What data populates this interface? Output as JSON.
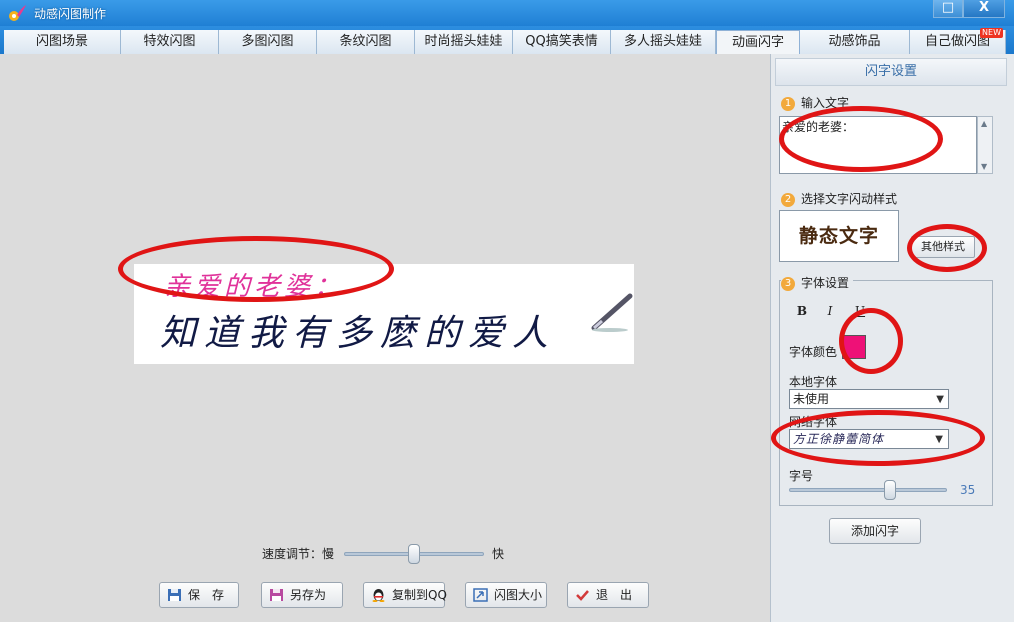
{
  "window": {
    "title": "动感闪图制作",
    "maximize_glyph": "□",
    "close_glyph": "X"
  },
  "tabs": [
    {
      "label": "闪图场景"
    },
    {
      "label": "特效闪图"
    },
    {
      "label": "多图闪图"
    },
    {
      "label": "条纹闪图"
    },
    {
      "label": "时尚摇头娃娃"
    },
    {
      "label": "QQ搞笑表情"
    },
    {
      "label": "多人摇头娃娃"
    },
    {
      "label": "动画闪字",
      "active": true
    },
    {
      "label": "动感饰品"
    },
    {
      "label": "自己做闪图",
      "badge": "NEW"
    }
  ],
  "preview": {
    "line1": "亲爱的老婆：",
    "line2": "知道我有多麽的爱人"
  },
  "speed": {
    "label": "速度调节：慢",
    "fast_label": "快",
    "level": 0.5
  },
  "buttons": {
    "save": "保　存",
    "save_as": "另存为",
    "copy_qq": "复制到QQ",
    "size": "闪图大小",
    "exit": "退　出"
  },
  "panel": {
    "title": "闪字设置",
    "step1": {
      "num": "1",
      "label": "输入文字",
      "text_value": "亲爱的老婆："
    },
    "step2": {
      "num": "2",
      "label": "选择文字闪动样式",
      "style_preview": "静态文字",
      "other_style": "其他样式"
    },
    "step3": {
      "num": "3",
      "label": "字体设置",
      "bold": "B",
      "italic": "I",
      "underline": "U",
      "color_label": "字体颜色",
      "font_color": "#ee1177",
      "local_font_label": "本地字体",
      "local_font_value": "未使用",
      "net_font_label": "网络字体",
      "net_font_value": "方正徐静蕾简体",
      "size_label": "字号",
      "size_value": "35",
      "size_level": 0.64
    },
    "add_button": "添加闪字"
  },
  "accent_colors": {
    "title_bar": "#1f7fd4",
    "annotation": "#e01515"
  }
}
